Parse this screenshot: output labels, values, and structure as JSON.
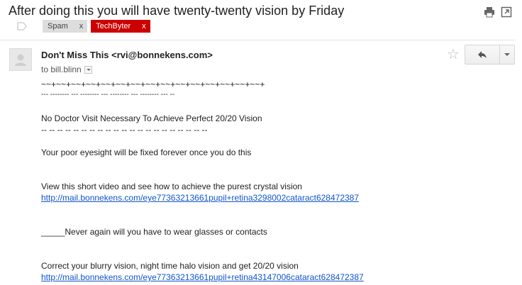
{
  "email": {
    "subject": "After doing this you will have twenty-twenty vision by Friday",
    "labels": [
      {
        "name": "Spam",
        "remove": "x"
      },
      {
        "name": "TechByter",
        "remove": "x"
      }
    ],
    "sender": "Don't Miss This <rvi@bonnekens.com>",
    "recipient": "to bill.blinn",
    "body": {
      "decor_line_1": "~~+~~+~~+~~+~~+~~+~~+~~+~~+~~+~~+~~+~~+~~+~~+",
      "decor_line_2": "--- -------- --- -------- --- -------- --- -------- --- --",
      "headline": "No Doctor Visit Necessary To Achieve Perfect 20/20 Vision",
      "headline_underline": "-- -- -- -- -- -- -- -- -- -- -- -- -- -- -- -- -- -- -- -- --",
      "para_1": "Your poor eyesight will be fixed forever once you do this",
      "para_2": "View this short video and see how to achieve the purest crystal vision",
      "link_1": "http://mail.bonnekens.com/eye77363213661pupil+retina3298002cataract628472387",
      "para_3": "_____Never again will you have to wear glasses or contacts",
      "para_4": "Correct your blurry vision, night time halo vision and get 20/20 vision",
      "link_2": "http://mail.bonnekens.com/eye77363213661pupil+retina43147006cataract628472387"
    }
  },
  "icons": {
    "print": "printer-icon",
    "new_window": "open-in-new-window-icon",
    "label_marker": "label-arrow-icon",
    "avatar": "default-avatar-icon",
    "star": "star-icon",
    "reply": "reply-icon",
    "more": "chevron-down-icon"
  },
  "colors": {
    "spam_tag": "#dddddd",
    "techbyter_tag": "#cc0000",
    "link": "#1155cc"
  }
}
